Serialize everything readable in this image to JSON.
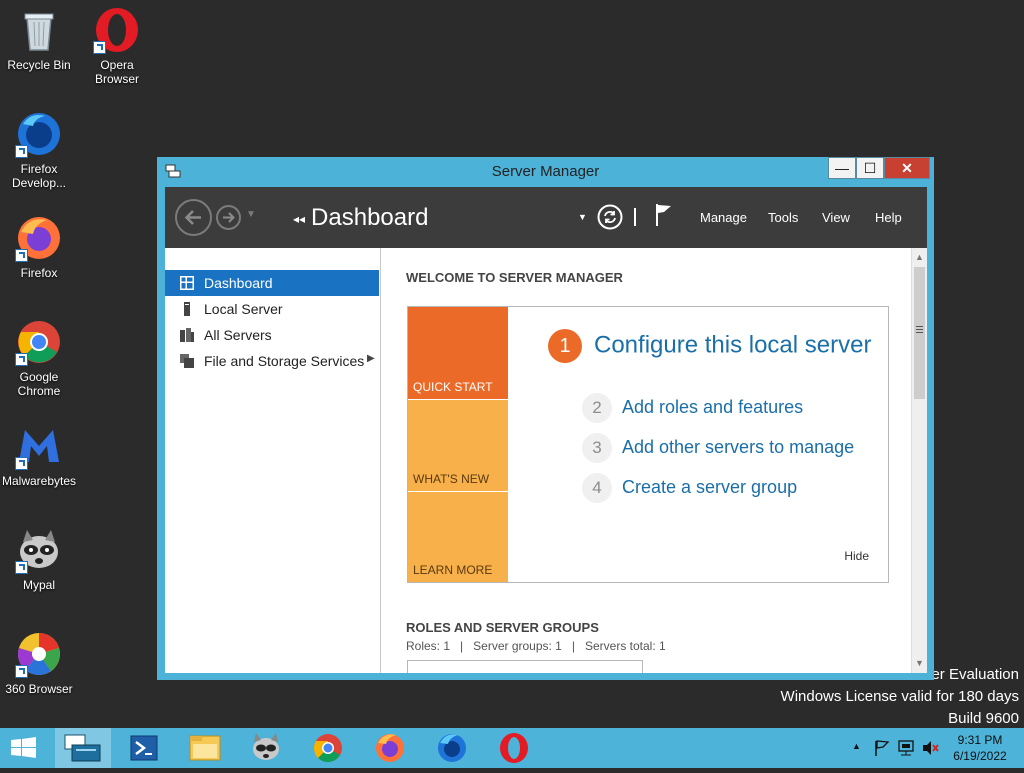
{
  "desktop": {
    "icons": [
      {
        "label": "Recycle Bin"
      },
      {
        "label": "Opera Browser"
      },
      {
        "label": "Firefox Develop..."
      },
      {
        "label": "Firefox"
      },
      {
        "label": "Google Chrome"
      },
      {
        "label": "Malwarebytes"
      },
      {
        "label": "Mypal"
      },
      {
        "label": "360 Browser"
      }
    ],
    "watermark": {
      "line1": "er Evaluation",
      "line2": "Windows License valid for 180 days",
      "line3": "Build 9600"
    }
  },
  "window": {
    "title": "Server Manager",
    "buttons": {
      "minimize": "—",
      "maximize": "☐",
      "close": "✕"
    }
  },
  "toolbar": {
    "breadcrumb": "Dashboard",
    "menu": [
      "Manage",
      "Tools",
      "View",
      "Help"
    ]
  },
  "nav": {
    "items": [
      {
        "label": "Dashboard",
        "active": true
      },
      {
        "label": "Local Server"
      },
      {
        "label": "All Servers"
      },
      {
        "label": "File and Storage Services"
      }
    ]
  },
  "content": {
    "welcome_heading": "WELCOME TO SERVER MANAGER",
    "tiles": [
      "QUICK START",
      "WHAT'S NEW",
      "LEARN MORE"
    ],
    "steps": [
      {
        "num": "1",
        "label": "Configure this local server"
      },
      {
        "num": "2",
        "label": "Add roles and features"
      },
      {
        "num": "3",
        "label": "Add other servers to manage"
      },
      {
        "num": "4",
        "label": "Create a server group"
      }
    ],
    "hide_label": "Hide",
    "roles_heading": "ROLES AND SERVER GROUPS",
    "roles_summary": "Roles: 1   |   Server groups: 1   |   Servers total: 1"
  },
  "taskbar": {
    "clock_time": "9:31 PM",
    "clock_date": "6/19/2022"
  },
  "colors": {
    "accent": "#1a73c2",
    "tile_quick_start": "#ec6a28",
    "tile_other": "#f7b04a",
    "window_frame": "#4cb2d8"
  }
}
